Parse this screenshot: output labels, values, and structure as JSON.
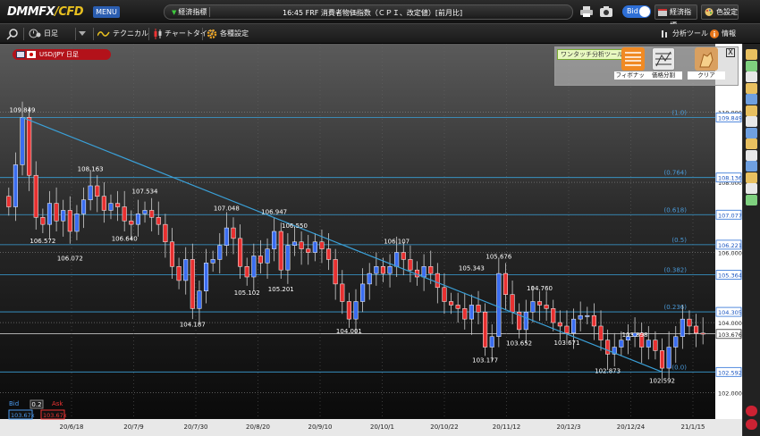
{
  "app": {
    "logo": {
      "dmm": "DMM",
      "fx": "FX",
      "slash": "/",
      "cfd": "CFD"
    },
    "menu_label": "MENU",
    "news_tag": "経済指標",
    "news_text": "16:45 FRF 消費者物価指数（ＣＰＩ、改定値）[前月比]",
    "bid_toggle": "Bid",
    "econ_button": "経済指標",
    "color_button": "色設定"
  },
  "toolbar": {
    "timeframe": "日足",
    "technical": "テクニカル",
    "chart_type": "チャートタイプ",
    "settings": "各種設定",
    "analysis_tool": "分析ツール",
    "info": "情報"
  },
  "symbol": {
    "label": "USD/JPY 日足"
  },
  "analysis_panel": {
    "title": "ワンタッチ分析ツール",
    "close": "X",
    "tools": [
      "フィボナッチ",
      "価格分割",
      "クリア"
    ]
  },
  "bid_ask": {
    "bid_label": "Bid",
    "bid_value": "0.2",
    "ask_label": "Ask",
    "bid_price": "103.67x",
    "ask_price": "103.67x"
  },
  "colors": {
    "accent": "#2a5db0",
    "up": "#3a6df0",
    "down": "#e83030",
    "fib_line": "#3aa0d8",
    "symbol_tab": "#b3121a"
  },
  "chart_data": {
    "type": "candlestick",
    "price_axis": {
      "ylim": [
        101.25,
        111.95
      ],
      "ticks": [
        {
          "value": 110.0,
          "label": "110.000"
        },
        {
          "value": 108.0,
          "label": "108.000"
        },
        {
          "value": 106.0,
          "label": "106.000"
        },
        {
          "value": 104.0,
          "label": "104.000"
        },
        {
          "value": 102.0,
          "label": "102.000"
        }
      ]
    },
    "price_tags": [
      {
        "value": 109.849,
        "label": "109.849"
      },
      {
        "value": 108.136,
        "label": "108.136"
      },
      {
        "value": 107.077,
        "label": "107.077"
      },
      {
        "value": 106.221,
        "label": "106.221"
      },
      {
        "value": 105.364,
        "label": "105.364"
      },
      {
        "value": 104.305,
        "label": "104.305"
      },
      {
        "value": 103.676,
        "label": "103.676"
      },
      {
        "value": 102.592,
        "label": "102.592"
      }
    ],
    "fibonacci": [
      {
        "level": "(1.0)",
        "value": 109.849
      },
      {
        "level": "(0.764)",
        "value": 108.136
      },
      {
        "level": "(0.618)",
        "value": 107.077
      },
      {
        "level": "(0.5)",
        "value": 106.221
      },
      {
        "level": "(0.382)",
        "value": 105.364
      },
      {
        "level": "(0.236)",
        "value": 104.305
      },
      {
        "level": "(0.0)",
        "value": 102.592
      }
    ],
    "x_labels": [
      "20/6/18",
      "20/7/9",
      "20/7/30",
      "20/8/20",
      "20/9/10",
      "20/10/1",
      "20/10/22",
      "20/11/12",
      "20/12/3",
      "20/12/24",
      "21/1/15"
    ],
    "annotations": [
      {
        "value": 109.849,
        "label": "109.849",
        "i": 2
      },
      {
        "value": 106.572,
        "label": "106.572",
        "i": 5
      },
      {
        "value": 106.072,
        "label": "106.072",
        "i": 9
      },
      {
        "value": 108.163,
        "label": "108.163",
        "i": 12
      },
      {
        "value": 106.64,
        "label": "106.640",
        "i": 17
      },
      {
        "value": 107.534,
        "label": "107.534",
        "i": 20
      },
      {
        "value": 104.187,
        "label": "104.187",
        "i": 27
      },
      {
        "value": 107.048,
        "label": "107.048",
        "i": 32
      },
      {
        "value": 105.102,
        "label": "105.102",
        "i": 35
      },
      {
        "value": 106.947,
        "label": "106.947",
        "i": 39
      },
      {
        "value": 105.201,
        "label": "105.201",
        "i": 40
      },
      {
        "value": 106.55,
        "label": "106.550",
        "i": 42
      },
      {
        "value": 104.001,
        "label": "104.001",
        "i": 50
      },
      {
        "value": 106.107,
        "label": "106.107",
        "i": 57
      },
      {
        "value": 105.343,
        "label": "105.343",
        "i": 68
      },
      {
        "value": 103.177,
        "label": "103.177",
        "i": 70
      },
      {
        "value": 105.676,
        "label": "105.676",
        "i": 72
      },
      {
        "value": 103.652,
        "label": "103.652",
        "i": 75
      },
      {
        "value": 104.76,
        "label": "104.760",
        "i": 78
      },
      {
        "value": 103.671,
        "label": "103.671",
        "i": 82
      },
      {
        "value": 103.898,
        "label": "103.898",
        "i": 92
      },
      {
        "value": 102.873,
        "label": "102.873",
        "i": 88
      },
      {
        "value": 102.592,
        "label": "102.592",
        "i": 96
      }
    ],
    "trendline": [
      {
        "i": 2,
        "value": 109.849
      },
      {
        "i": 96,
        "value": 102.592
      }
    ],
    "closes": [
      107.3,
      108.5,
      109.85,
      108.2,
      107.0,
      106.8,
      107.4,
      106.9,
      107.2,
      106.6,
      107.1,
      107.5,
      107.9,
      107.6,
      107.2,
      107.4,
      107.3,
      106.9,
      106.8,
      107.1,
      107.2,
      107.0,
      106.8,
      106.3,
      105.6,
      105.2,
      105.8,
      104.4,
      104.9,
      105.7,
      105.8,
      106.2,
      106.7,
      106.4,
      105.6,
      105.3,
      105.9,
      105.7,
      106.1,
      106.6,
      105.5,
      106.2,
      106.3,
      106.1,
      106.0,
      106.3,
      106.1,
      105.8,
      105.1,
      104.6,
      104.1,
      104.6,
      105.1,
      105.4,
      105.6,
      105.4,
      105.6,
      106.0,
      105.8,
      105.5,
      105.3,
      105.6,
      105.4,
      105.0,
      104.6,
      104.5,
      104.4,
      104.1,
      104.5,
      104.3,
      103.3,
      103.6,
      105.4,
      104.8,
      104.3,
      103.8,
      104.3,
      104.6,
      104.5,
      104.4,
      104.0,
      103.9,
      103.7,
      104.1,
      104.2,
      104.2,
      103.9,
      103.5,
      103.1,
      103.3,
      103.5,
      103.6,
      103.7,
      103.3,
      103.5,
      103.2,
      102.7,
      103.3,
      103.6,
      104.1,
      103.9,
      103.7,
      103.68
    ]
  }
}
